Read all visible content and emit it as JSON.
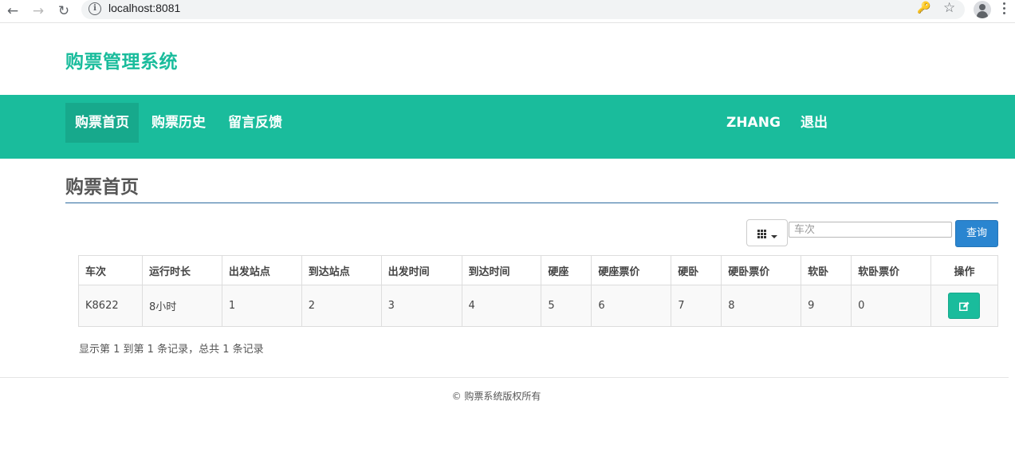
{
  "browser": {
    "url": "localhost:8081"
  },
  "brand": "购票管理系统",
  "nav": {
    "items": [
      {
        "label": "购票首页"
      },
      {
        "label": "购票历史"
      },
      {
        "label": "留言反馈"
      }
    ],
    "user": "ZHANG",
    "logout": "退出"
  },
  "page_title": "购票首页",
  "toolbar": {
    "search_placeholder": "车次",
    "query_label": "查询"
  },
  "table": {
    "headers": [
      "车次",
      "运行时长",
      "出发站点",
      "到达站点",
      "出发时间",
      "到达时间",
      "硬座",
      "硬座票价",
      "硬卧",
      "硬卧票价",
      "软卧",
      "软卧票价",
      "操作"
    ],
    "rows": [
      [
        "K8622",
        "8小时",
        "1",
        "2",
        "3",
        "4",
        "5",
        "6",
        "7",
        "8",
        "9",
        "0"
      ]
    ]
  },
  "pager_info": "显示第 1 到第 1 条记录，总共 1 条记录",
  "footer": "© 购票系统版权所有",
  "colors": {
    "accent": "#1abc9c",
    "primary_button": "#2a85d0"
  }
}
